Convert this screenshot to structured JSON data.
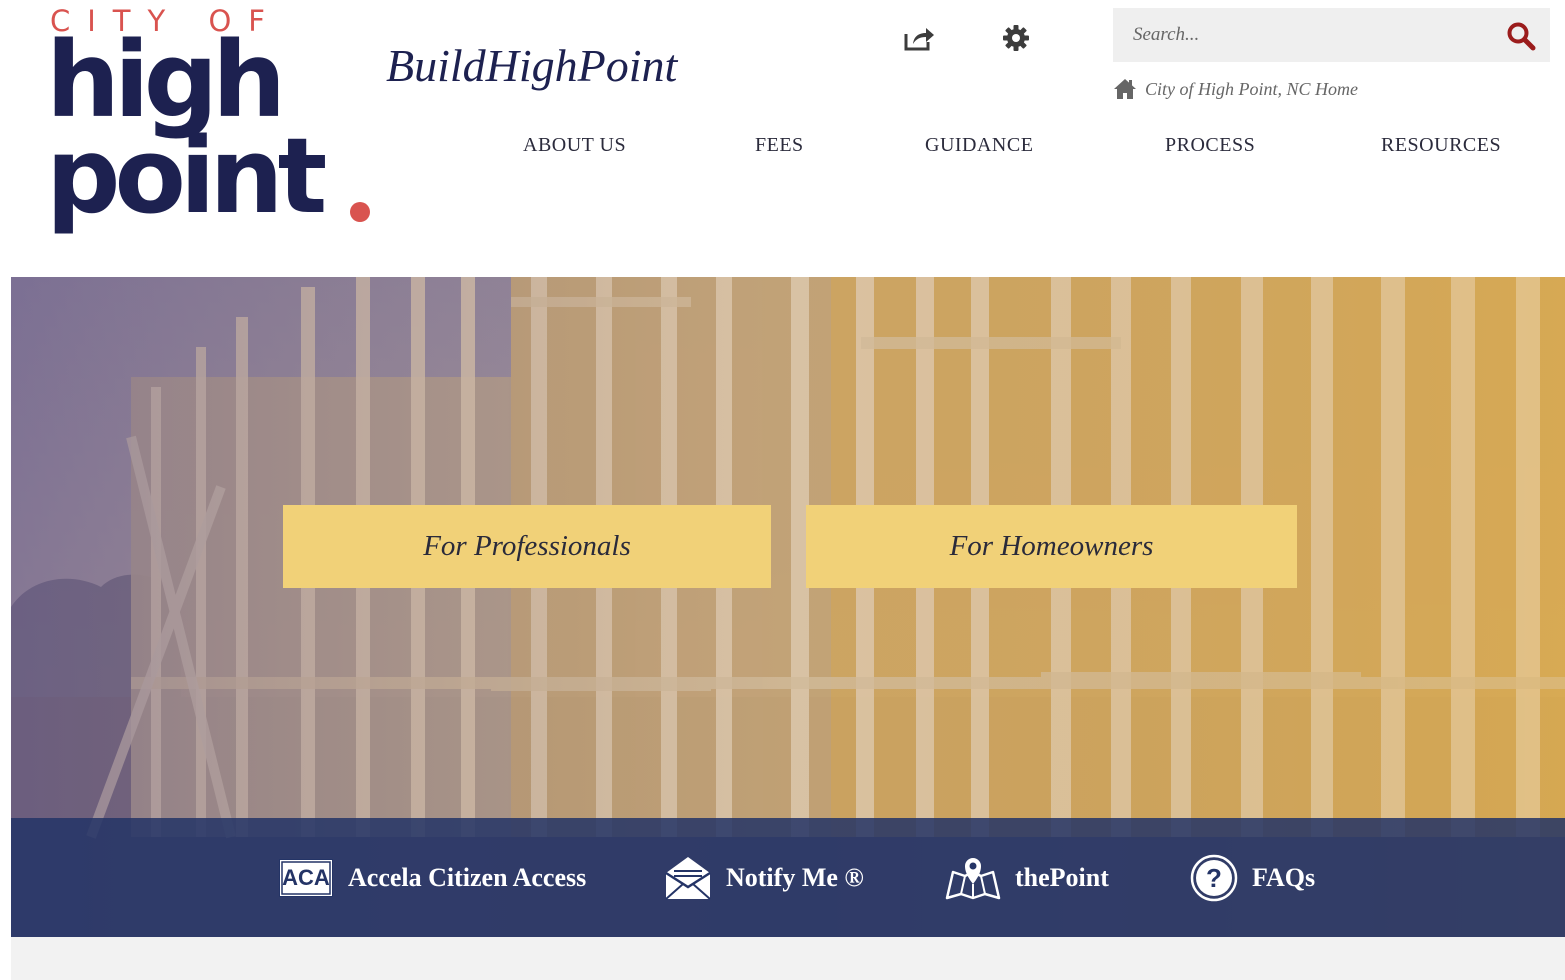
{
  "logo": {
    "city_of": "CITY OF",
    "high": "high",
    "point": "point"
  },
  "site_title": "BuildHighPoint",
  "toolbar": {
    "share_icon": "share-icon",
    "settings_icon": "gear-icon"
  },
  "search": {
    "placeholder": "Search...",
    "icon": "search-icon"
  },
  "home_link": {
    "label": "City of High Point, NC Home",
    "icon": "home-icon"
  },
  "nav": {
    "items": [
      {
        "label": "ABOUT US"
      },
      {
        "label": "FEES"
      },
      {
        "label": "GUIDANCE"
      },
      {
        "label": "PROCESS"
      },
      {
        "label": "RESOURCES"
      }
    ]
  },
  "hero": {
    "cta_professionals": "For Professionals",
    "cta_homeowners": "For Homeowners"
  },
  "quicklinks": {
    "items": [
      {
        "label": "Accela Citizen Access",
        "badge": "ACA",
        "icon": "aca-icon"
      },
      {
        "label": "Notify Me ®",
        "icon": "envelope-icon"
      },
      {
        "label": "thePoint",
        "icon": "map-pin-icon"
      },
      {
        "label": "FAQs",
        "icon": "question-circle-icon"
      }
    ]
  },
  "colors": {
    "navy": "#1d2150",
    "accent_red": "#d9534f",
    "cta_yellow": "#f1d178",
    "quicklinks_bar": "#243466",
    "search_icon": "#9b1c1c"
  }
}
